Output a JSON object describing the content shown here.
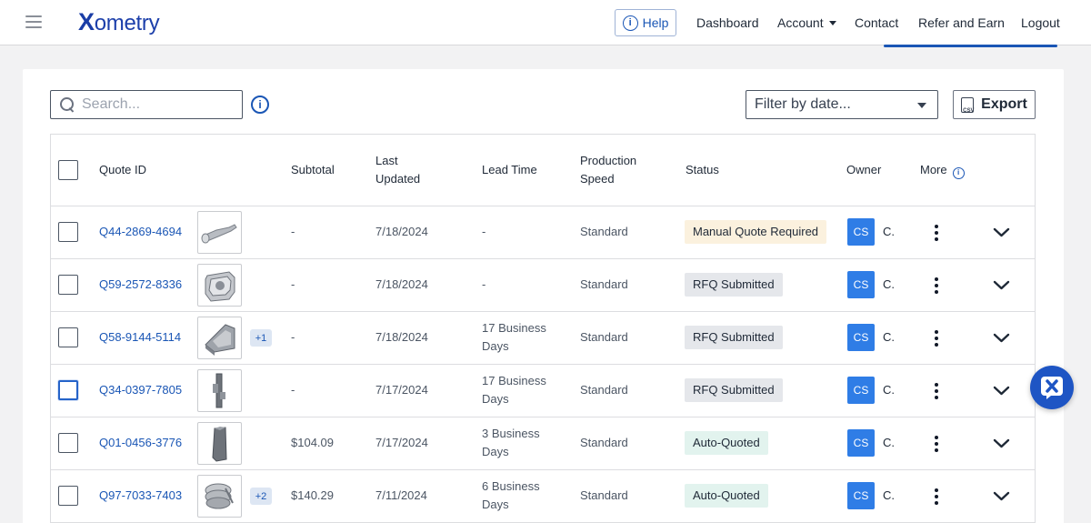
{
  "app": {
    "logo_text": "ometry",
    "logo_x": "X",
    "brand_color": "#1a3da6"
  },
  "nav": {
    "help": "Help",
    "dashboard": "Dashboard",
    "account": "Account",
    "contact": "Contact",
    "refer": "Refer and Earn",
    "logout": "Logout"
  },
  "toolbar": {
    "search_placeholder": "Search...",
    "filter_placeholder": "Filter by date...",
    "export_label": "Export"
  },
  "table": {
    "headers": {
      "quote_id": "Quote ID",
      "subtotal": "Subtotal",
      "last_updated_1": "Last",
      "last_updated_2": "Updated",
      "lead_time": "Lead Time",
      "production_1": "Production",
      "production_2": "Speed",
      "status": "Status",
      "owner": "Owner",
      "more": "More"
    },
    "rows": [
      {
        "id": "Q44-2869-4694",
        "extra": "",
        "subtotal": "-",
        "updated": "7/18/2024",
        "lead1": "-",
        "lead2": "",
        "speed": "Standard",
        "status": "Manual Quote Required",
        "status_kind": "manual",
        "initials": "CS",
        "owner": "C."
      },
      {
        "id": "Q59-2572-8336",
        "extra": "",
        "subtotal": "-",
        "updated": "7/18/2024",
        "lead1": "-",
        "lead2": "",
        "speed": "Standard",
        "status": "RFQ Submitted",
        "status_kind": "rfq",
        "initials": "CS",
        "owner": "C."
      },
      {
        "id": "Q58-9144-5114",
        "extra": "+1",
        "subtotal": "-",
        "updated": "7/18/2024",
        "lead1": "17 Business",
        "lead2": "Days",
        "speed": "Standard",
        "status": "RFQ Submitted",
        "status_kind": "rfq",
        "initials": "CS",
        "owner": "C."
      },
      {
        "id": "Q34-0397-7805",
        "extra": "",
        "subtotal": "-",
        "updated": "7/17/2024",
        "lead1": "17 Business",
        "lead2": "Days",
        "speed": "Standard",
        "status": "RFQ Submitted",
        "status_kind": "rfq",
        "initials": "CS",
        "owner": "C."
      },
      {
        "id": "Q01-0456-3776",
        "extra": "",
        "subtotal": "$104.09",
        "updated": "7/17/2024",
        "lead1": "3 Business",
        "lead2": "Days",
        "speed": "Standard",
        "status": "Auto-Quoted",
        "status_kind": "auto",
        "initials": "CS",
        "owner": "C."
      },
      {
        "id": "Q97-7033-7403",
        "extra": "+2",
        "subtotal": "$140.29",
        "updated": "7/11/2024",
        "lead1": "6 Business",
        "lead2": "Days",
        "speed": "Standard",
        "status": "Auto-Quoted",
        "status_kind": "auto",
        "initials": "CS",
        "owner": "C."
      }
    ]
  },
  "status_colors": {
    "manual": "#fbf1de",
    "rfq": "#e5e7eb",
    "auto": "#e2f3ee"
  },
  "icons": [
    "menu-icon",
    "info-icon",
    "search-icon",
    "chevron-down-icon",
    "csv-file-icon",
    "kebab-icon",
    "xometry-chat-icon"
  ]
}
